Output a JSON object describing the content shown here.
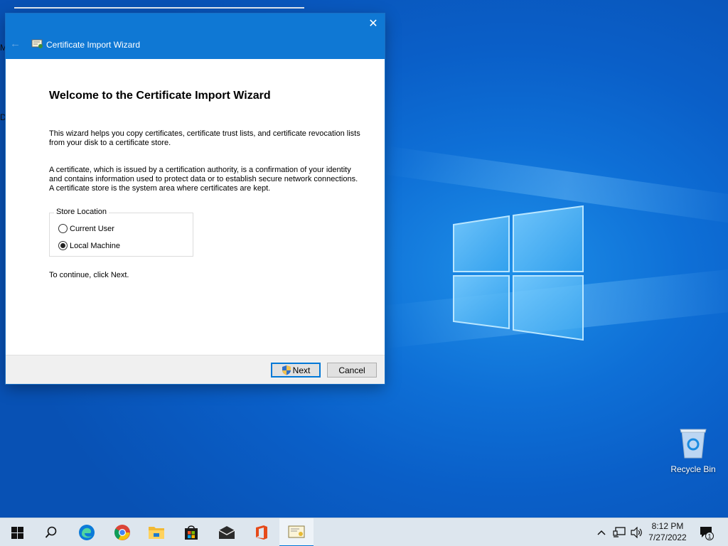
{
  "dialog": {
    "title": "Certificate Import Wizard",
    "close_glyph": "✕",
    "back_glyph": "←",
    "heading": "Welcome to the Certificate Import Wizard",
    "para1": "This wizard helps you copy certificates, certificate trust lists, and certificate revocation lists from your disk to a certificate store.",
    "para2": "A certificate, which is issued by a certification authority, is a confirmation of your identity and contains information used to protect data or to establish secure network connections. A certificate store is the system area where certificates are kept.",
    "store_location": {
      "legend": "Store Location",
      "options": [
        {
          "label": "Current User",
          "selected": false
        },
        {
          "label": "Local Machine",
          "selected": true
        }
      ]
    },
    "continue_text": "To continue, click Next.",
    "buttons": {
      "next": "Next",
      "cancel": "Cancel"
    }
  },
  "desktop": {
    "recycle_bin_label": "Recycle Bin",
    "left_fragments": [
      "M",
      "D"
    ]
  },
  "taskbar": {
    "apps": [
      {
        "name": "start",
        "icon": "windows-start-icon"
      },
      {
        "name": "search",
        "icon": "search-icon"
      },
      {
        "name": "edge",
        "icon": "edge-icon"
      },
      {
        "name": "chrome",
        "icon": "chrome-icon"
      },
      {
        "name": "file-explorer",
        "icon": "folder-icon"
      },
      {
        "name": "store",
        "icon": "store-icon"
      },
      {
        "name": "mail",
        "icon": "mail-icon"
      },
      {
        "name": "office",
        "icon": "office-icon"
      },
      {
        "name": "certificate-wizard",
        "icon": "certificate-icon",
        "active": true
      }
    ],
    "tray": {
      "chevron": "^",
      "network_icon": "network-icon",
      "volume_icon": "volume-icon"
    },
    "time": "8:12 PM",
    "date": "7/27/2022",
    "notification_count": "1"
  },
  "colors": {
    "titlebar": "#0f78d4",
    "accent": "#0078d7",
    "desktop": "#0a5fc8",
    "taskbar": "#dde6ee"
  }
}
